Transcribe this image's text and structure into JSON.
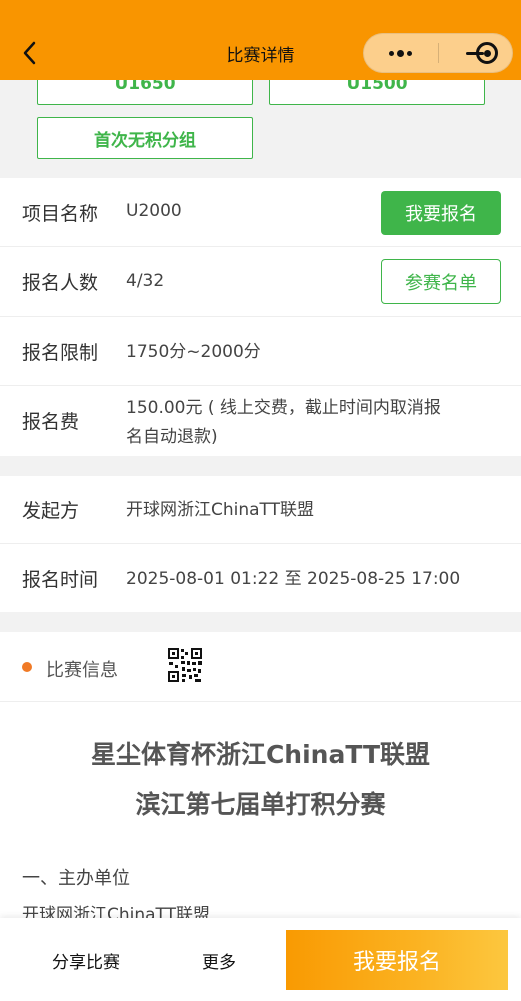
{
  "header": {
    "title": "比赛详情",
    "accent_color": "#f99500",
    "back_icon": "chevron-left-icon",
    "menu_icon": "more-dots-icon",
    "minimize_icon": "minimize-icon",
    "close_icon": "target-close-icon"
  },
  "groups": [
    "U1650",
    "U1500",
    "首次无积分组"
  ],
  "event": {
    "name_label": "项目名称",
    "name_value": "U2000",
    "signup_label": "我要报名",
    "count_label": "报名人数",
    "count_value": "4/32",
    "roster_label": "参赛名单",
    "limit_label": "报名限制",
    "limit_value": "1750分~2000分",
    "fee_label": "报名费",
    "fee_value_line1": "150.00元 ( 线上交费，截止时间内取消报",
    "fee_value_line2": "名自动退款)"
  },
  "organizer": {
    "label": "发起方",
    "value": "开球网浙江ChinaTT联盟",
    "time_label": "报名时间",
    "time_value": "2025-08-01 01:22 至 2025-08-25 17:00"
  },
  "info": {
    "label": "比赛信息",
    "qr_icon": "qr-code-icon",
    "title_line1": "星尘体育杯浙江ChinaTT联盟",
    "title_line2": "滨江第七届单打积分赛",
    "section1_heading": "一、主办单位",
    "section1_text": "开球网浙江ChinaTT联盟"
  },
  "bottom": {
    "share": "分享比赛",
    "more": "更多",
    "signup": "我要报名"
  },
  "colors": {
    "green": "#3fb54a",
    "orange_dot": "#f07a26"
  }
}
